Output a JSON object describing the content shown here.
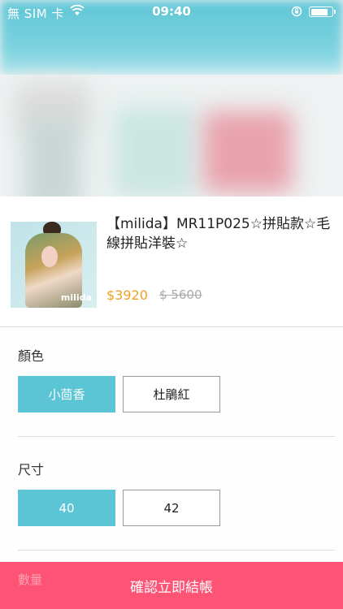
{
  "status_bar": {
    "carrier": "無 SIM 卡",
    "time": "09:40",
    "battery_level": 0.85
  },
  "product": {
    "title": "【milida】MR11P025☆拼貼款☆毛線拼貼洋裝☆",
    "image_brand": "milida",
    "price_now": "$3920",
    "price_original": "$ 5600"
  },
  "options": {
    "color_label": "顏色",
    "colors": [
      "小茴香",
      "杜鵑紅"
    ],
    "size_label": "尺寸",
    "sizes": [
      "40",
      "42"
    ]
  },
  "footer": {
    "quantity_label": "數量",
    "checkout_label": "確認立即結帳"
  },
  "colors": {
    "accent": "#5bc5d6",
    "cta": "#fd5374",
    "price": "#f0a020"
  }
}
